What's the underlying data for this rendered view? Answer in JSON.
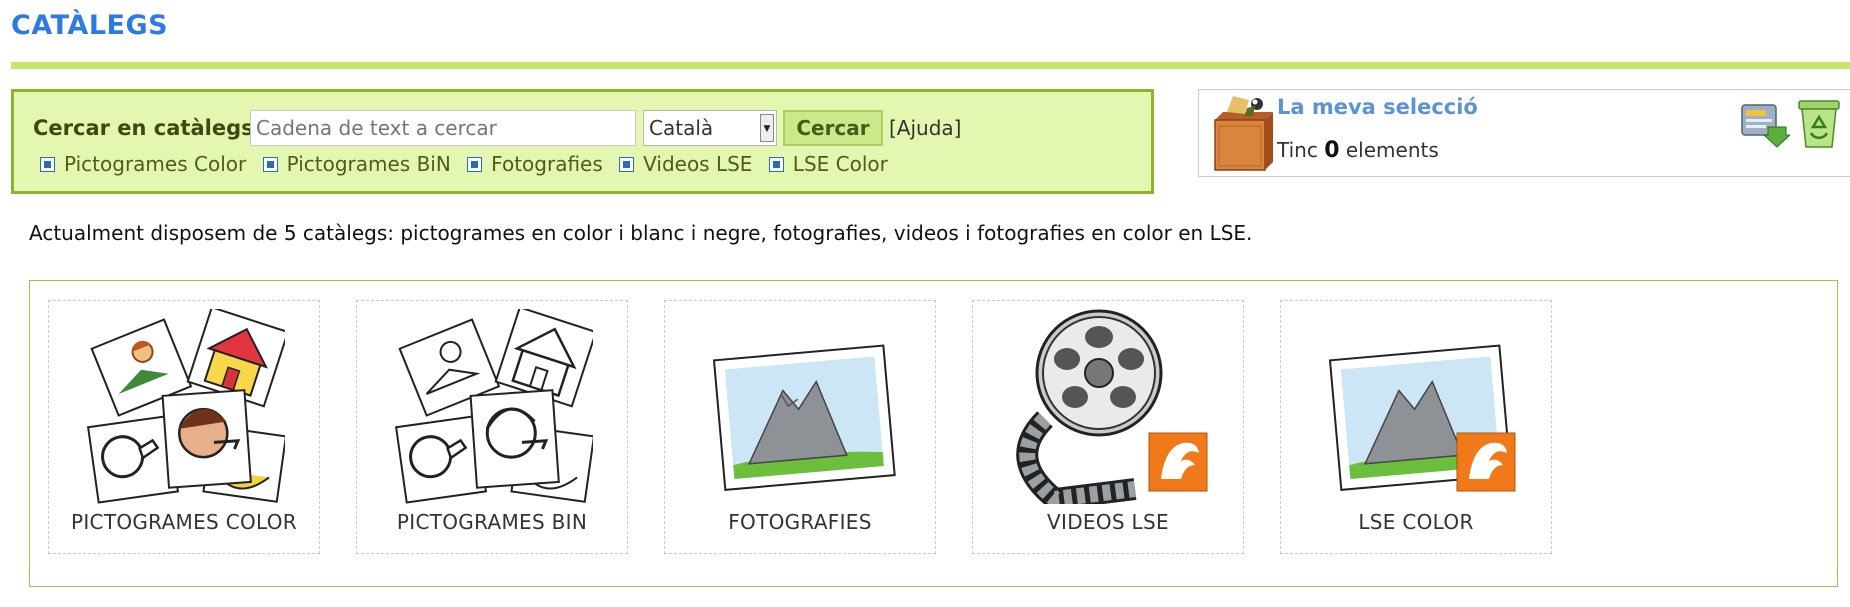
{
  "header": {
    "title": "CATÀLEGS"
  },
  "search": {
    "label": "Cercar en catàlegs:",
    "placeholder": "Cadena de text a cercar",
    "language": "Català",
    "button": "Cercar",
    "help": "[Ajuda]",
    "filters": [
      "Pictogrames Color",
      "Pictogrames BiN",
      "Fotografies",
      "Videos LSE",
      "LSE Color"
    ]
  },
  "selection": {
    "title": "La meva selecció",
    "prefix": "Tinc",
    "count": "0",
    "suffix": "elements"
  },
  "intro": "Actualment disposem de 5 catàlegs: pictogrames en color i blanc i negre, fotografies, videos i fotografies en color en LSE.",
  "catalogs": [
    {
      "label": "PICTOGRAMES COLOR",
      "icon": "color-pictograms-icon"
    },
    {
      "label": "PICTOGRAMES BIN",
      "icon": "bw-pictograms-icon"
    },
    {
      "label": "FOTOGRAFIES",
      "icon": "photo-icon"
    },
    {
      "label": "VIDEOS LSE",
      "icon": "film-reel-icon"
    },
    {
      "label": "LSE COLOR",
      "icon": "lse-photo-icon"
    }
  ],
  "colors": {
    "title": "#2d7be0",
    "accent_green": "#c6e66a",
    "panel_bg": "#e4f7b0",
    "panel_border": "#8cb42e",
    "lse_orange": "#f07a1a"
  }
}
